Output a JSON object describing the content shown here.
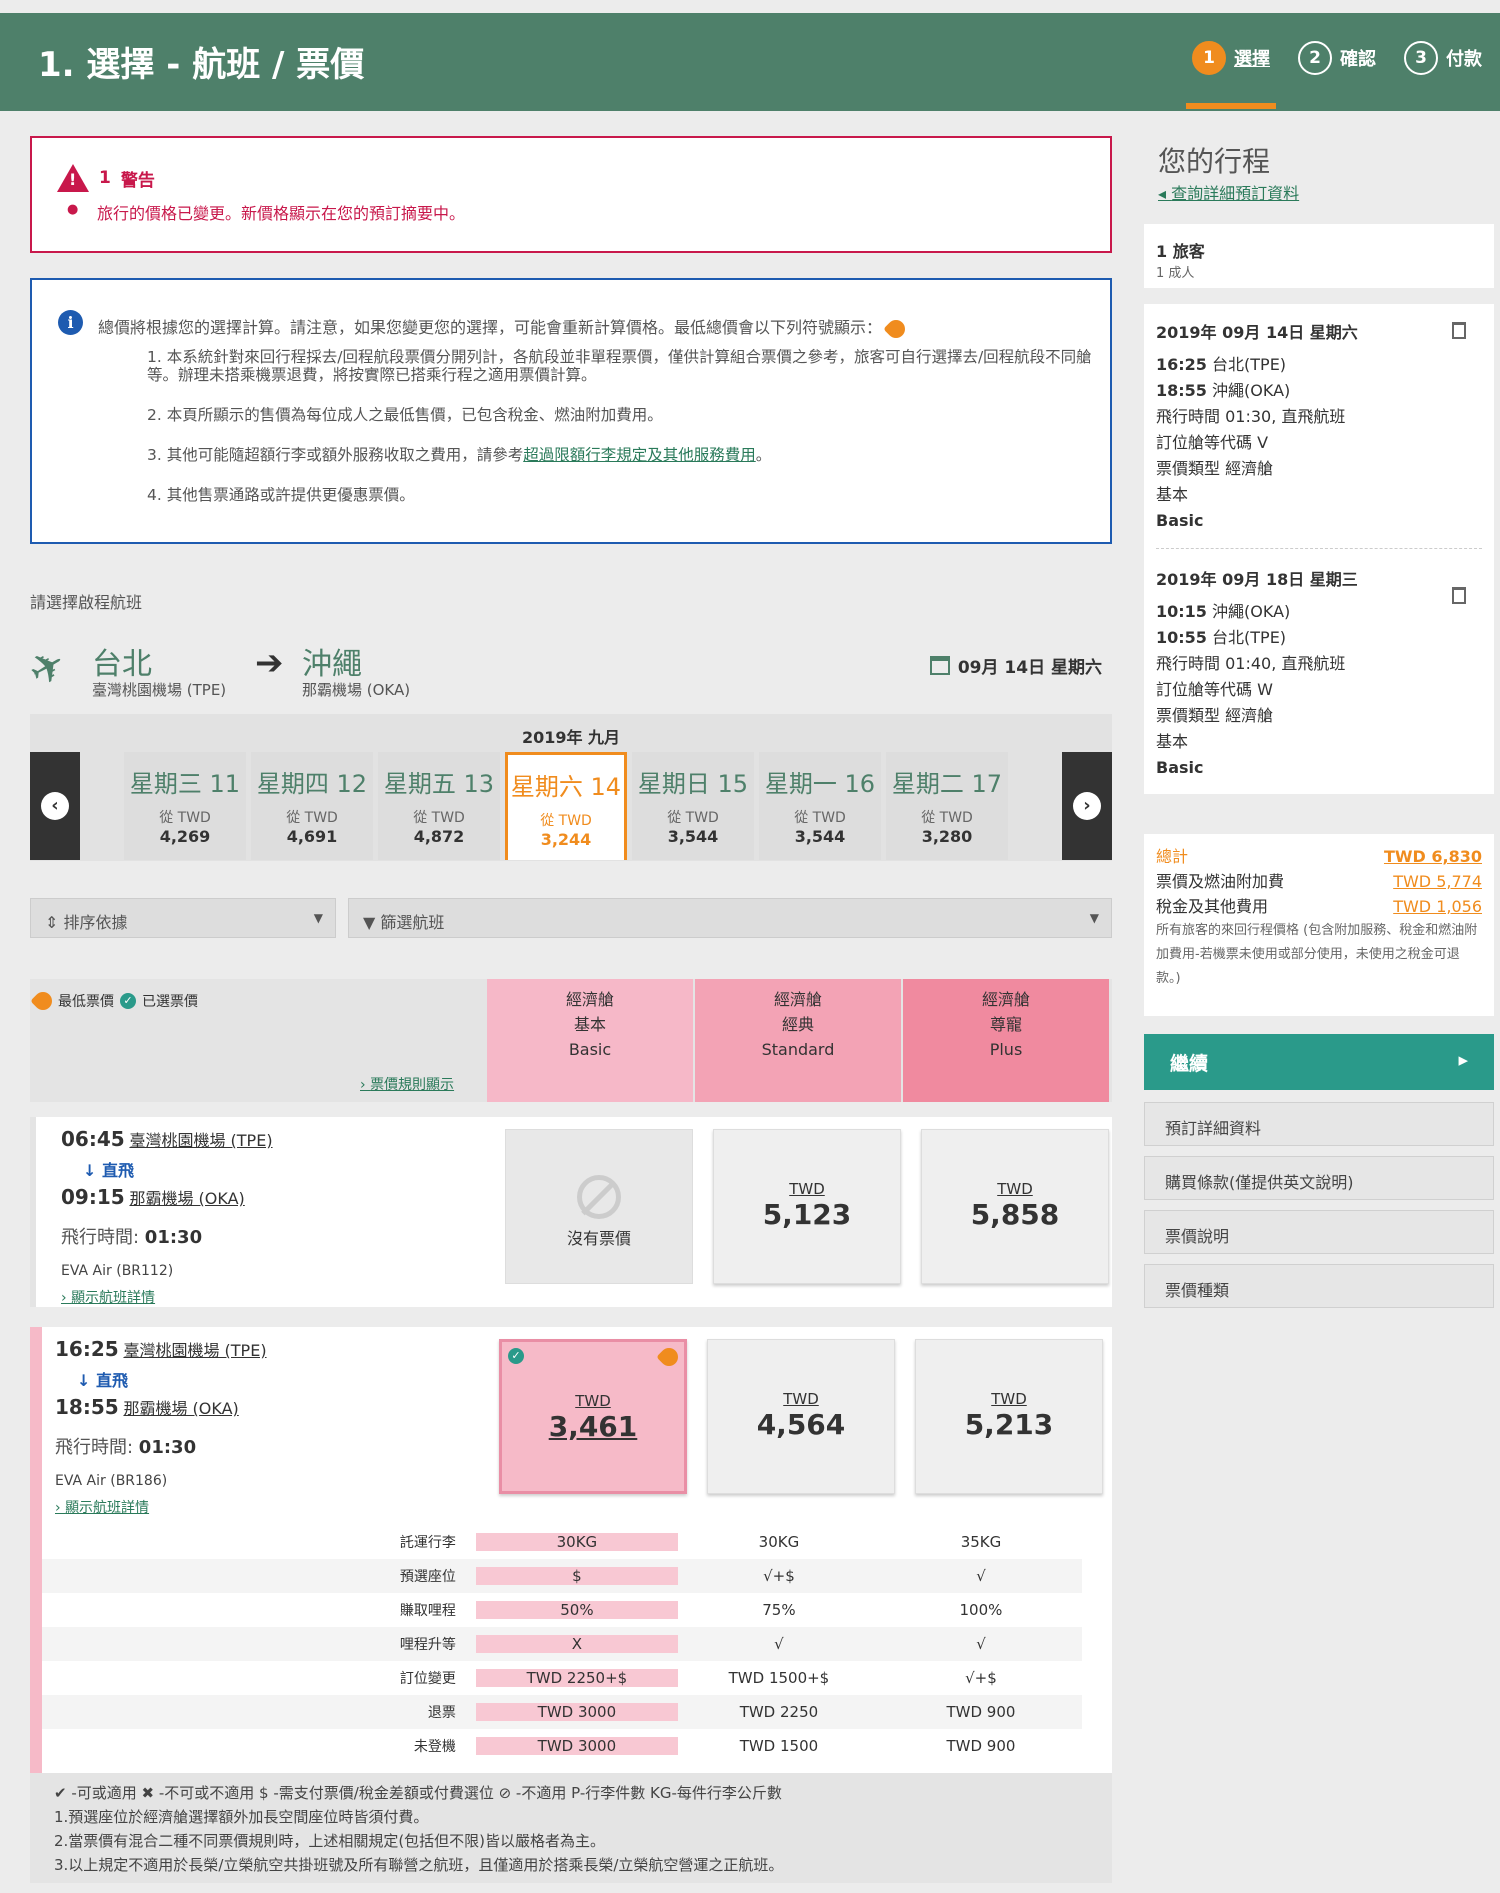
{
  "header": {
    "title": "1. 選擇 - 航班 / 票價",
    "steps": [
      {
        "num": "1",
        "label": "選擇"
      },
      {
        "num": "2",
        "label": "確認"
      },
      {
        "num": "3",
        "label": "付款"
      }
    ]
  },
  "warning": {
    "count": "1",
    "label": "警告",
    "message": "旅行的價格已變更。新價格顯示在您的預訂摘要中。"
  },
  "info": {
    "intro": "總價將根據您的選擇計算。請注意，如果您變更您的選擇，可能會重新計算價格。最低總價會以下列符號顯示：",
    "items": [
      "1. 本系統針對來回行程採去/回程航段票價分開列計，各航段並非單程票價，僅供計算組合票價之參考，旅客可自行選擇去/回程航段不同艙等。辦理未搭乘機票退費，將按實際已搭乘行程之適用票價計算。",
      "2. 本頁所顯示的售價為每位成人之最低售價，已包含稅金、燃油附加費用。",
      "3. 其他可能隨超額行李或額外服務收取之費用，請參考",
      "4. 其他售票通路或許提供更優惠票價。"
    ],
    "link": "超過限額行李規定及其他服務費用",
    "link_suffix": "。"
  },
  "select_label": "請選擇啟程航班",
  "route": {
    "from_city": "台北",
    "from_airport": "臺灣桃園機場 (TPE)",
    "to_city": "沖繩",
    "to_airport": "那霸機場 (OKA)",
    "date": "09月 14日 星期六"
  },
  "calendar": {
    "month": "2019年 九月",
    "days": [
      {
        "day": "星期三 11",
        "from": "從 TWD",
        "price": "4,269"
      },
      {
        "day": "星期四 12",
        "from": "從 TWD",
        "price": "4,691"
      },
      {
        "day": "星期五 13",
        "from": "從 TWD",
        "price": "4,872"
      },
      {
        "day": "星期六 14",
        "from": "從 TWD",
        "price": "3,244"
      },
      {
        "day": "星期日 15",
        "from": "從 TWD",
        "price": "3,544"
      },
      {
        "day": "星期一 16",
        "from": "從 TWD",
        "price": "3,544"
      },
      {
        "day": "星期二 17",
        "from": "從 TWD",
        "price": "3,280"
      }
    ]
  },
  "sort": {
    "sort_label": "排序依據",
    "filter_label": "篩選航班"
  },
  "fare_head": {
    "lowest": "最低票價",
    "selected": "已選票價",
    "rules": "票價規則顯示",
    "types": [
      {
        "l1": "經濟艙",
        "l2": "基本",
        "l3": "Basic",
        "color": "#f6b8c8"
      },
      {
        "l1": "經濟艙",
        "l2": "經典",
        "l3": "Standard",
        "color": "#f3a3b5"
      },
      {
        "l1": "經濟艙",
        "l2": "尊寵",
        "l3": "Plus",
        "color": "#f08a9f"
      }
    ]
  },
  "flights": [
    {
      "dep_time": "06:45",
      "dep_ap": "臺灣桃園機場 (TPE)",
      "direct": "直飛",
      "arr_time": "09:15",
      "arr_ap": "那霸機場 (OKA)",
      "dur_label": "飛行時間: ",
      "dur": "01:30",
      "carrier": "EVA Air (BR112)",
      "details": "顯示航班詳情",
      "none": "沒有票價",
      "prices": [
        {
          "cur": "TWD",
          "val": "5,123"
        },
        {
          "cur": "TWD",
          "val": "5,858"
        }
      ]
    },
    {
      "dep_time": "16:25",
      "dep_ap": "臺灣桃園機場 (TPE)",
      "direct": "直飛",
      "arr_time": "18:55",
      "arr_ap": "那霸機場 (OKA)",
      "dur_label": "飛行時間: ",
      "dur": "01:30",
      "carrier": "EVA Air (BR186)",
      "details": "顯示航班詳情",
      "prices": [
        {
          "cur": "TWD",
          "val": "3,461"
        },
        {
          "cur": "TWD",
          "val": "4,564"
        },
        {
          "cur": "TWD",
          "val": "5,213"
        }
      ]
    }
  ],
  "fare_table": [
    {
      "k": "託運行李",
      "v": [
        "30KG",
        "30KG",
        "35KG"
      ]
    },
    {
      "k": "預選座位",
      "v": [
        "$",
        "√+$",
        "√"
      ]
    },
    {
      "k": "賺取哩程",
      "v": [
        "50%",
        "75%",
        "100%"
      ]
    },
    {
      "k": "哩程升等",
      "v": [
        "X",
        "√",
        "√"
      ]
    },
    {
      "k": "訂位變更",
      "v": [
        "TWD 2250+$",
        "TWD 1500+$",
        "√+$"
      ]
    },
    {
      "k": "退票",
      "v": [
        "TWD 3000",
        "TWD 2250",
        "TWD 900"
      ]
    },
    {
      "k": "未登機",
      "v": [
        "TWD 3000",
        "TWD 1500",
        "TWD 900"
      ]
    }
  ],
  "notes": [
    "✔ -可或適用  ✖ -不可或不適用  $ -需支付票價/稅金差額或付費選位  ⊘ -不適用 P-行李件數 KG-每件行李公斤數",
    "1.預選座位於經濟艙選擇額外加長空間座位時皆須付費。",
    "2.當票價有混合二種不同票價規則時，上述相關規定(包括但不限)皆以嚴格者為主。",
    "3.以上規定不適用於長榮/立榮航空共掛班號及所有聯營之航班，且僅適用於搭乘長榮/立榮航空營運之正航班。"
  ],
  "sidebar": {
    "title": "您的行程",
    "detail_link": "查詢詳細預訂資料",
    "pax": "1 旅客",
    "pax_sub": "1 成人",
    "legs": [
      {
        "date": "2019年 09月 14日 星期六",
        "dep": "16:25",
        "dep_ap": "台北(TPE)",
        "arr": "18:55",
        "arr_ap": "沖繩(OKA)",
        "dur": "飛行時間 01:30, 直飛航班",
        "cls": "訂位艙等代碼 V",
        "ftype": "票價類型 經濟艙",
        "b1": "基本",
        "b2": "Basic"
      },
      {
        "date": "2019年 09月 18日 星期三",
        "dep": "10:15",
        "dep_ap": "沖繩(OKA)",
        "arr": "10:55",
        "arr_ap": "台北(TPE)",
        "dur": "飛行時間 01:40, 直飛航班",
        "cls": "訂位艙等代碼 W",
        "ftype": "票價類型 經濟艙",
        "b1": "基本",
        "b2": "Basic"
      }
    ],
    "total_label": "總計",
    "total": "TWD 6,830",
    "fare_label": "票價及燃油附加費",
    "fare": "TWD 5,774",
    "tax_label": "稅金及其他費用",
    "tax": "TWD 1,056",
    "note": "所有旅客的來回行程價格 (包含附加服務、稅金和燃油附加費用-若機票未使用或部分使用，未使用之稅金可退款。)",
    "continue": "繼續",
    "buttons": [
      "預訂詳細資料",
      "購買條款(僅提供英文說明)",
      "票價說明",
      "票價種類"
    ]
  }
}
